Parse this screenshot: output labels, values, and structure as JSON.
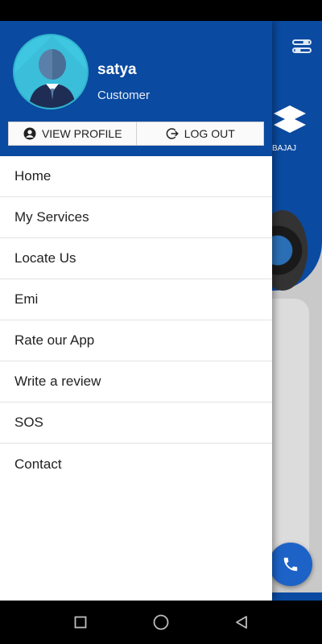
{
  "drawer": {
    "header": {
      "user_name": "satya",
      "user_role": "Customer",
      "bg_color": "#0a4aa0",
      "avatar_color": "#3fc6e0"
    },
    "actions": [
      {
        "label": "VIEW PROFILE",
        "icon": "account-circle-icon"
      },
      {
        "label": "LOG OUT",
        "icon": "logout-icon"
      }
    ],
    "menu": [
      {
        "label": "Home"
      },
      {
        "label": "My Services"
      },
      {
        "label": "Locate Us"
      },
      {
        "label": "Emi"
      },
      {
        "label": "Rate our App"
      },
      {
        "label": "Write a review"
      },
      {
        "label": "SOS"
      },
      {
        "label": "Contact"
      }
    ]
  },
  "background": {
    "brand_text": "BAJAJ",
    "fab_icon": "phone-icon",
    "settings_icon": "settings-icon",
    "accent": "#1d63c7"
  },
  "nav_bar": {
    "buttons": [
      "recent-apps-icon",
      "home-icon",
      "back-icon"
    ]
  }
}
